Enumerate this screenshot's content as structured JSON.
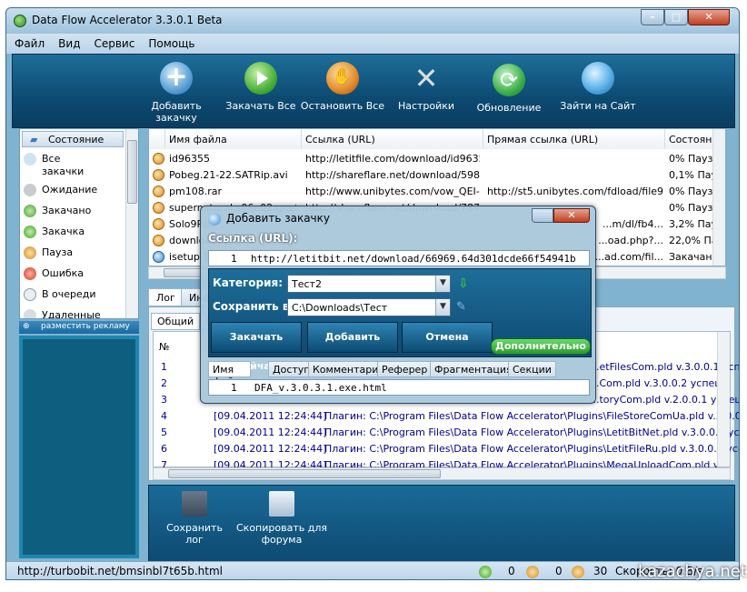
{
  "window": {
    "title": "Data Flow Accelerator 3.3.0.1 Beta"
  },
  "menu": [
    "Файл",
    "Вид",
    "Сервис",
    "Помощь"
  ],
  "toolbar": [
    {
      "label": "Добавить закачку",
      "icon": "add-download-icon"
    },
    {
      "label": "Закачать Все",
      "icon": "play-icon"
    },
    {
      "label": "Остановить Все",
      "icon": "stop-hand-icon"
    },
    {
      "label": "Настройки",
      "icon": "settings-tools-icon"
    },
    {
      "label": "Обновление",
      "icon": "update-icon"
    },
    {
      "label": "Зайти на Сайт",
      "icon": "globe-icon"
    }
  ],
  "sidebar": {
    "header": "Состояние",
    "items": [
      {
        "label": "Все закачки"
      },
      {
        "label": "Ожидание"
      },
      {
        "label": "Закачано"
      },
      {
        "label": "Закачка"
      },
      {
        "label": "Пауза"
      },
      {
        "label": "Ошибка"
      },
      {
        "label": "В очереди"
      },
      {
        "label": "Удаленные"
      }
    ],
    "ad_label": "разместить рекламу"
  },
  "downloads": {
    "columns": [
      "Имя файла",
      "Ссылка (URL)",
      "Прямая ссылка (URL)",
      "Состояние"
    ],
    "rows": [
      {
        "name": "id96355",
        "url": "http://letitfile.com/download/id96355",
        "direct": "",
        "status": "0% Пауза"
      },
      {
        "name": "Pobeg.21-22.SATRip.avi",
        "url": "http://shareflare.net/download/5984...",
        "direct": "",
        "status": "0,1% Пауза"
      },
      {
        "name": "pm108.rar",
        "url": "http://www.unibytes.com/vow_QEI-...",
        "direct": "http://st5.unibytes.com/fdload/file9e...",
        "status": "0% Пауза"
      },
      {
        "name": "supernatural.s06e02.gnefi...",
        "url": "http://shareflare.net/download/7870...",
        "direct": "",
        "status": "0% Пауза"
      },
      {
        "name": "Solo9Rus...",
        "url": "",
        "direct": "...m/dl/fb4...",
        "status": "3,2% Пауза"
      },
      {
        "name": "download...",
        "url": "",
        "direct": "...oad.php?...",
        "status": "22,0% Пауза"
      },
      {
        "name": "isetup-5...",
        "url": "",
        "direct": "...ad.com/fil...",
        "status": "Закачано"
      }
    ]
  },
  "lower_tabs": [
    "Лог",
    "Инф..."
  ],
  "log": {
    "tabs": [
      "Общий",
      "ID"
    ],
    "header": "№",
    "rows": [
      {
        "n": "1",
        "t": "",
        "m": "...etFilesCom.pld v.3.0.0.1 успешн"
      },
      {
        "n": "2",
        "t": "",
        "m": "...Com.pld v.3.0.0.2 успешн"
      },
      {
        "n": "3",
        "t": "",
        "m": "...toryCom.pld v.2.0.0.1 успешн"
      },
      {
        "n": "4",
        "t": "[09.04.2011 12:24:44]",
        "m": "Плагин: C:\\Program Files\\Data Flow Accelerator\\Plugins\\FileStoreComUa.pld v.3.0.0.1 успешн"
      },
      {
        "n": "5",
        "t": "[09.04.2011 12:24:44]",
        "m": "Плагин: C:\\Program Files\\Data Flow Accelerator\\Plugins\\LetitBitNet.pld v.3.0.0.2 успешно"
      },
      {
        "n": "6",
        "t": "[09.04.2011 12:24:44]",
        "m": "Плагин: C:\\Program Files\\Data Flow Accelerator\\Plugins\\LetitFileRu.pld v.3.0.0.1 успешн"
      },
      {
        "n": "7",
        "t": "[09.04.2011 12:24:44]",
        "m": "Плагин: C:\\Program Files\\Data Flow Accelerator\\Plugins\\MegaUploadCom.pld v.2.0.0.1 успешн"
      }
    ]
  },
  "bottom_buttons": [
    {
      "label": "Сохранить лог",
      "icon": "save-disk-icon"
    },
    {
      "label": "Скопировать для форума",
      "icon": "copy-icon"
    }
  ],
  "status": {
    "url": "http://turbobit.net/bmsinbl7t65b.html",
    "active": "0",
    "paused": "0",
    "total": "30",
    "speed": "Скорость: 0 B/s"
  },
  "dialog": {
    "title": "Добавить закачку",
    "url_label": "Ссылка (URL):",
    "url_index": "1",
    "url_value": "http://letitbit.net/download/66969.64d301dcde66f54941b",
    "category_label": "Категория:",
    "category_value": "Тест2",
    "save_label": "Сохранить в:",
    "save_value": "C:\\Downloads\\Тест",
    "btn_download_now": "Закачать Сейчас",
    "btn_add": "Добавить",
    "btn_cancel": "Отмена",
    "btn_more": "Дополнительно",
    "tabs": [
      "Имя файла",
      "Доступ",
      "Комментарий",
      "Реферер",
      "Фрагментация",
      "Секции"
    ],
    "file_index": "1",
    "file_value": "DFA_v.3.0.3.1.exe.html"
  },
  "watermark": "kazachya.net"
}
